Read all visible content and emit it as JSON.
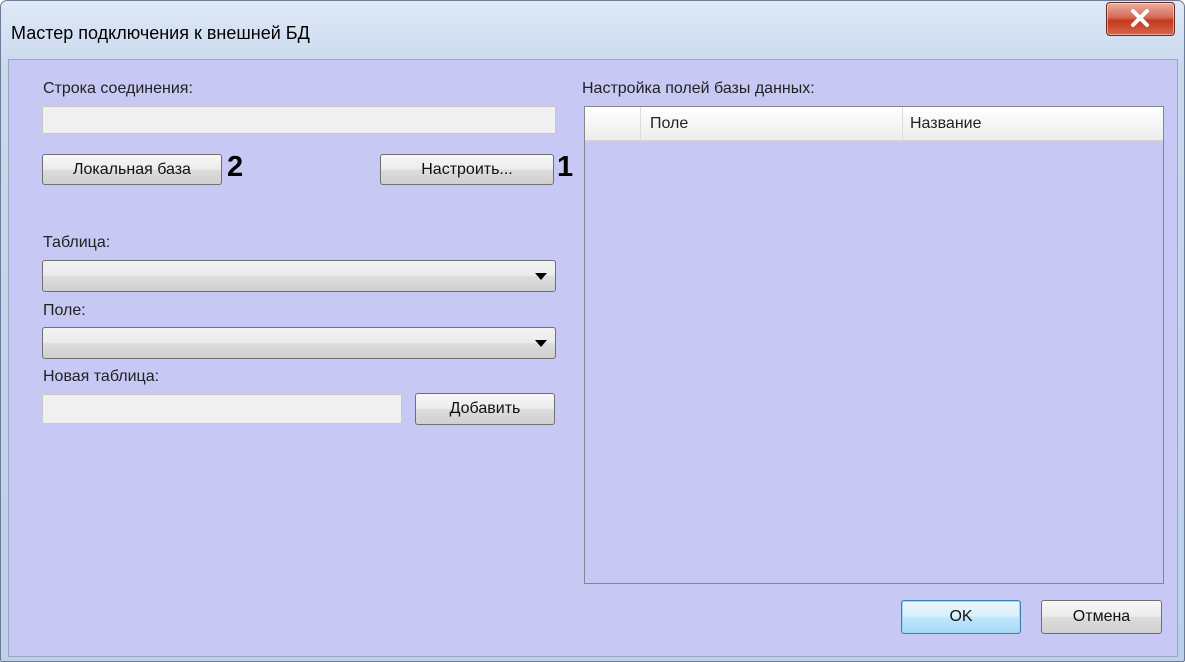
{
  "window": {
    "title": "Мастер подключения к внешней БД"
  },
  "connection": {
    "label": "Строка соединения:",
    "value": "",
    "local_db_button": "Локальная база",
    "configure_button": "Настроить...",
    "marker_local": "2",
    "marker_configure": "1"
  },
  "table_select": {
    "label": "Таблица:",
    "selected": ""
  },
  "field_select": {
    "label": "Поле:",
    "selected": ""
  },
  "new_table": {
    "label": "Новая таблица:",
    "value": "",
    "add_button": "Добавить"
  },
  "db_fields": {
    "label": "Настройка полей базы данных:",
    "columns": [
      "Поле",
      "Название"
    ],
    "rows": []
  },
  "footer": {
    "ok_button": "OK",
    "cancel_button": "Отмена"
  },
  "colors": {
    "client_bg": "#c8c8f4",
    "close_button": "#c7442a"
  },
  "icons": {
    "close": "close-icon",
    "dropdown": "chevron-down-icon"
  }
}
